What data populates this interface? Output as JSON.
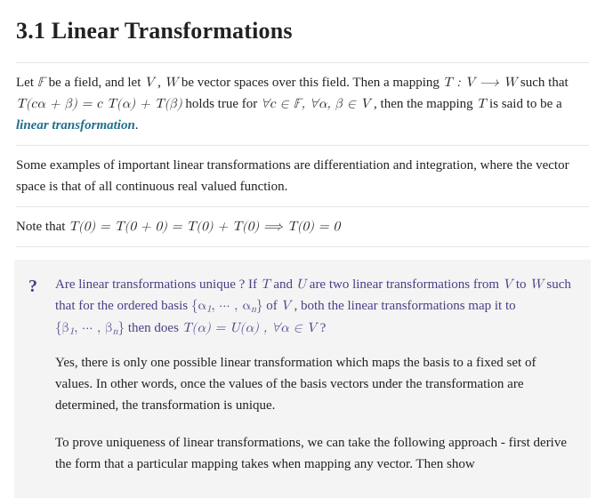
{
  "heading": "3.1 Linear Transformations",
  "para1": {
    "t1": "Let ",
    "m1": "𝔽",
    "t2": " be a field, and let ",
    "m2": "V",
    "t3": " , ",
    "m3": "W",
    "t4": " be vector spaces over this field. Then a mapping ",
    "m4": "T : V  ⟶  W",
    "t5": " such that ",
    "m5": "T(cα + β) = c T(α) + T(β)",
    "t6": " holds true for ",
    "m6": "∀c ∈ 𝔽, ∀α, β ∈ V",
    "t7": ", then the mapping ",
    "m7": "T",
    "t8": " is said to be a ",
    "link": "linear transformation",
    "t9": "."
  },
  "para2": "Some examples of important linear transformations are differentiation and integration, where the vector space is that of all continuous real valued function.",
  "para3": {
    "t1": "Note that ",
    "m1": "T(0) = T(0 + 0) = T(0) + T(0)  ⟹  T(0) = 0"
  },
  "callout": {
    "qmark": "?",
    "question": {
      "t1": "Are linear transformations unique ? If ",
      "m1": "T",
      "t2": " and ",
      "m2": "U",
      "t3": " are two linear transformations from ",
      "m3": "V",
      "t4": " to ",
      "m4": "W",
      "t5": " such that for the ordered basis ",
      "m5a": "{α",
      "m5b": ", ⋯ , α",
      "m5c": "}",
      "sub1": "1",
      "subn": "n",
      "t6": " of ",
      "m6": "V",
      "t7": ", both the linear transformations map it to ",
      "m7a": "{β",
      "m7b": ", ⋯ , β",
      "m7c": "}",
      "t8": " then does ",
      "m8": "T(α) = U(α) ,  ∀α ∈ V",
      "t9": " ?"
    },
    "answer1": "Yes, there is only one possible linear transformation which maps the basis to a fixed set of values. In other words, once the values of the basis vectors under the transformation are determined, the transformation is unique.",
    "answer2": "To prove uniqueness of linear transformations, we can take the following approach - first derive the form that a particular mapping takes when mapping any vector. Then show"
  }
}
